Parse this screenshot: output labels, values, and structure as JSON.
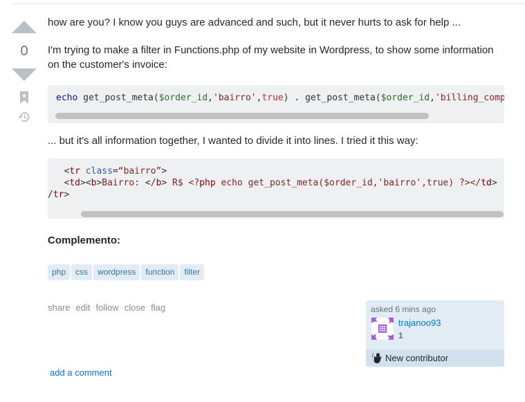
{
  "vote": {
    "count": "0",
    "upvote_label": "upvote",
    "downvote_label": "downvote"
  },
  "post": {
    "paragraphs": [
      "how are you? I know you guys are advanced and such, but it never hurts to ask for help ...",
      "I'm trying to make a filter in Functions.php of my website in Wordpress, to show some information on the customer's invoice:",
      "... but it's all information together, I wanted to divide it into lines. I tried it this way:"
    ],
    "code1": {
      "echo": "echo",
      "fn1": " get_post_meta(",
      "var1": "$order_id",
      "comma1": ",",
      "str1": "'bairro'",
      "comma2": ",",
      "true1": "true",
      "mid": ") . get_post_meta(",
      "var2": "$order_id",
      "comma3": ",",
      "str2": "'billing_comp"
    },
    "code2": {
      "l1_indent": "   ",
      "l1_open": "<",
      "l1_tag": "tr",
      "l1_attr": " class",
      "l1_eq": "=",
      "l1_val": "“bairro”",
      "l1_close": ">",
      "l2_indent": "   ",
      "l2_a": "<",
      "l2_td": "td",
      "l2_b1": "><",
      "l2_b": "b",
      "l2_c": ">",
      "l2_text": "Bairro: ",
      "l2_d": "</",
      "l2_b2": "b",
      "l2_e": "> ",
      "l2_rs": "R$ <?",
      "l2_php": "php",
      "l2_rest": " echo get_post_meta(",
      "l2_var": "$order_id",
      "l2_com": ",",
      "l2_str": "'bairro'",
      "l2_com2": ",",
      "l2_true": "true",
      "l2_end": ") ?></",
      "l2_td2": "td",
      "l2_gt": ">",
      "l3_slash": "/",
      "l3_tr": "tr",
      "l3_gt": ">"
    },
    "heading": "Complemento:",
    "tags": [
      "php",
      "css",
      "wordpress",
      "function",
      "filter"
    ],
    "menu": [
      "share",
      "edit",
      "follow",
      "close",
      "flag"
    ]
  },
  "owner": {
    "asked": "asked 6 mins ago",
    "username": "trajanoo93",
    "reputation": "1",
    "badge": "New contributor",
    "avatar_color": "#a25ddc"
  },
  "add_comment": "add a comment"
}
